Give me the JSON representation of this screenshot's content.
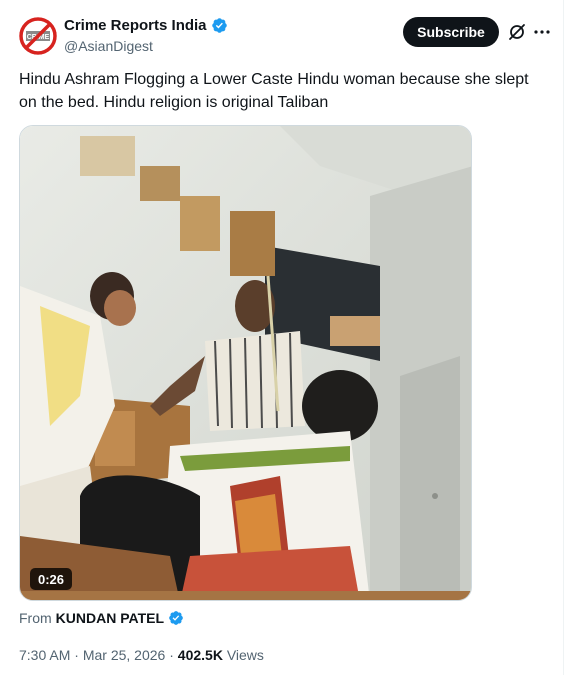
{
  "header": {
    "avatar_text": "CRIME",
    "display_name": "Crime Reports India",
    "handle": "@AsianDigest",
    "subscribe_label": "Subscribe"
  },
  "tweet": {
    "text": "Hindu Ashram Flogging a Lower Caste Hindu woman because she slept on the bed. Hindu religion is original Taliban"
  },
  "media": {
    "duration": "0:26"
  },
  "attribution": {
    "prefix": "From",
    "name": "KUNDAN PATEL"
  },
  "meta": {
    "time": "7:30 AM",
    "date": "Mar 25, 2026",
    "views_count": "402.5K",
    "views_label": "Views"
  },
  "colors": {
    "verified": "#1d9bf0",
    "text_primary": "#0f1419",
    "text_secondary": "#536471",
    "avatar_red": "#d7231f"
  }
}
